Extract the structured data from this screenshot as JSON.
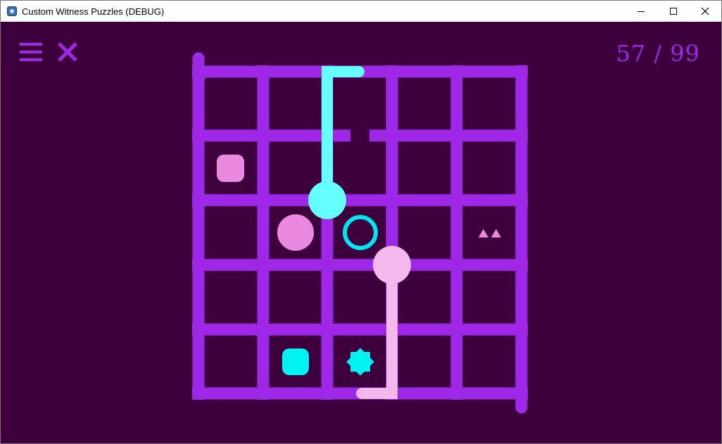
{
  "window": {
    "title": "Custom Witness Puzzles (DEBUG)",
    "minimize_icon": "minimize-icon",
    "maximize_icon": "maximize-icon",
    "close_icon": "close-icon"
  },
  "toolbar": {
    "menu_icon": "hamburger-menu-icon",
    "exit_icon": "x-close-icon"
  },
  "progress": {
    "current": "57",
    "separator": " / ",
    "total": "99"
  },
  "colors": {
    "background": "#3d003d",
    "grid": "#9f28e8",
    "path_cyan": "#66ffff",
    "path_pink": "#f4b8ec",
    "symbol_pink": "#e98ae0",
    "symbol_cyan": "#00f2f2"
  },
  "puzzle": {
    "grid_size": [
      5,
      5
    ],
    "symbols": [
      {
        "type": "square",
        "color": "pink",
        "cell": [
          0,
          1
        ]
      },
      {
        "type": "circle",
        "color": "pink",
        "cell": [
          1,
          2
        ]
      },
      {
        "type": "ring",
        "color": "cyan",
        "cell": [
          2,
          2
        ]
      },
      {
        "type": "triangles",
        "count": 2,
        "color": "pink",
        "cell": [
          4,
          2
        ]
      },
      {
        "type": "square",
        "color": "cyan",
        "cell": [
          1,
          4
        ]
      },
      {
        "type": "star",
        "color": "cyan",
        "cell": [
          2,
          4
        ]
      }
    ],
    "paths": [
      {
        "color": "cyan",
        "description": "start at node (2,2), up to top edge, ends short near node (2.5,0)"
      },
      {
        "color": "pink",
        "description": "start at node (3,3), down to bottom edge, ends short near node (2.5,5)"
      }
    ]
  }
}
